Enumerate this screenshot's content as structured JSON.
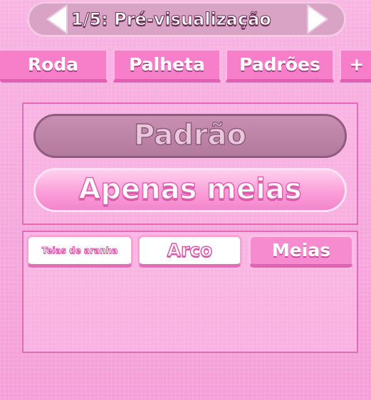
{
  "header": {
    "title": "1/5: Pré-visualização",
    "prev_icon": "arrow-left-icon",
    "next_icon": "arrow-right-icon"
  },
  "tabs": [
    {
      "label": "Roda"
    },
    {
      "label": "Palheta"
    },
    {
      "label": "Padrões"
    },
    {
      "label": "+"
    }
  ],
  "mode_buttons": {
    "standard": "Padrão",
    "socks_only": "Apenas meias"
  },
  "sub_tabs": [
    {
      "label": "Teias de aranha"
    },
    {
      "label": "Arco"
    },
    {
      "label": "Meias"
    }
  ],
  "colors": {
    "background": "#f7a9dd",
    "tab": "#f77fc9",
    "selected_mode": "#b47a9d",
    "accent_outline": "#e26cb8"
  }
}
